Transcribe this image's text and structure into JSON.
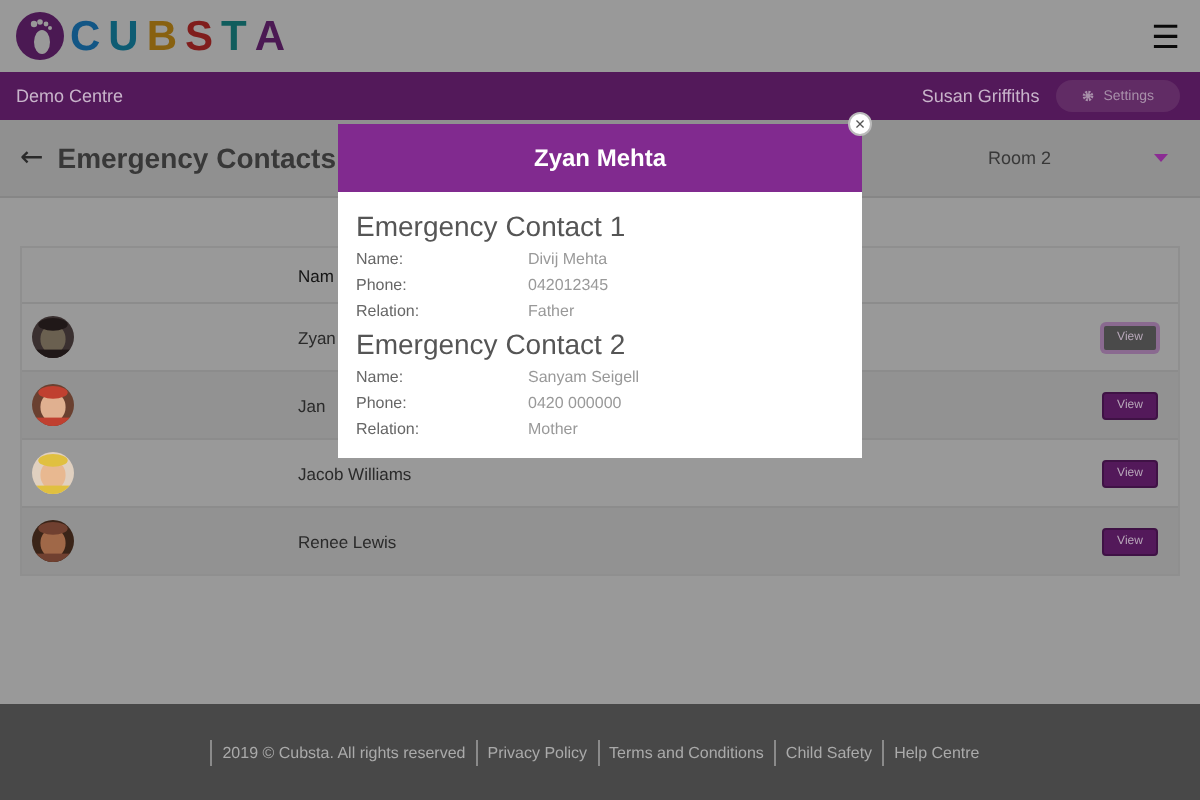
{
  "logo": {
    "letters": [
      {
        "text": "C",
        "color": "#125685"
      },
      {
        "text": "U",
        "color": "#0e5c73"
      },
      {
        "text": "B",
        "color": "#886110"
      },
      {
        "text": "S",
        "color": "#801d1c"
      },
      {
        "text": "T",
        "color": "#105d5d"
      },
      {
        "text": "A",
        "color": "#4b1953"
      }
    ]
  },
  "menu_icon": "☰",
  "nav": {
    "centre": "Demo Centre",
    "user": "Susan Griffiths",
    "settings": "Settings"
  },
  "page": {
    "back": "←",
    "title": "Emergency Contacts",
    "room": "Room 2"
  },
  "table": {
    "columns": [
      "Nam"
    ],
    "rows": [
      {
        "name": "Zyan",
        "button": "View",
        "active": true
      },
      {
        "name": "Jan",
        "button": "View",
        "active": false
      },
      {
        "name": "Jacob Williams",
        "button": "View",
        "active": false
      },
      {
        "name": "Renee Lewis",
        "button": "View",
        "active": false
      }
    ]
  },
  "modal": {
    "title": "Zyan Mehta",
    "close": "×",
    "sections": [
      {
        "heading": "Emergency Contact 1",
        "fields": [
          {
            "label": "Name:",
            "value": "Divij Mehta"
          },
          {
            "label": "Phone:",
            "value": "042012345"
          },
          {
            "label": "Relation:",
            "value": "Father"
          }
        ]
      },
      {
        "heading": "Emergency Contact 2",
        "fields": [
          {
            "label": "Name:",
            "value": "Sanyam Seigell"
          },
          {
            "label": "Phone:",
            "value": "0420 000000"
          },
          {
            "label": "Relation:",
            "value": "Mother"
          }
        ]
      }
    ]
  },
  "footer": {
    "copyright": "2019 © Cubsta. All rights reserved",
    "links": [
      "Privacy Policy",
      "Terms and Conditions",
      "Child Safety",
      "Help Centre"
    ]
  }
}
